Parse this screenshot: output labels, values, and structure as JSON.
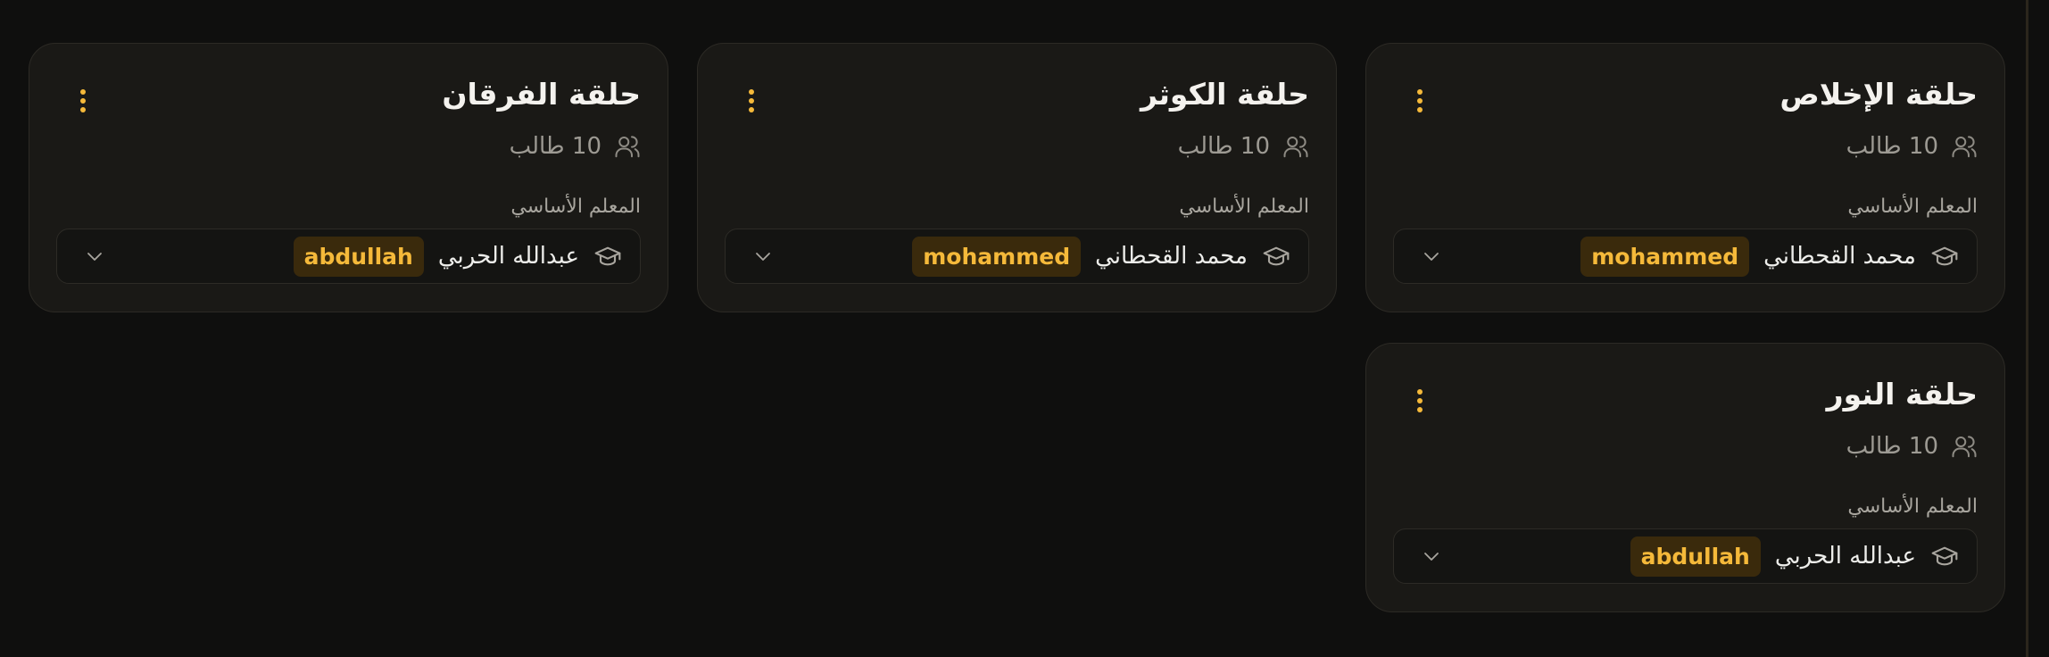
{
  "circles": [
    {
      "title": "حلقة الإخلاص",
      "students": "10 طالب",
      "teacher_label": "المعلم الأساسي",
      "teacher_name": "محمد القحطاني",
      "teacher_username": "mohammed"
    },
    {
      "title": "حلقة الكوثر",
      "students": "10 طالب",
      "teacher_label": "المعلم الأساسي",
      "teacher_name": "محمد القحطاني",
      "teacher_username": "mohammed"
    },
    {
      "title": "حلقة الفرقان",
      "students": "10 طالب",
      "teacher_label": "المعلم الأساسي",
      "teacher_name": "عبدالله الحربي",
      "teacher_username": "abdullah"
    },
    {
      "title": "حلقة النور",
      "students": "10 طالب",
      "teacher_label": "المعلم الأساسي",
      "teacher_name": "عبدالله الحربي",
      "teacher_username": "abdullah"
    }
  ],
  "icons": {
    "menu": "more-vertical-icon",
    "students": "users-icon",
    "teacher": "graduation-cap-icon",
    "dropdown": "chevron-down-icon"
  },
  "colors": {
    "background": "#0f0f0e",
    "card": "#1a1916",
    "accent": "#f5b93a",
    "badge_bg": "#3a2a0c"
  }
}
